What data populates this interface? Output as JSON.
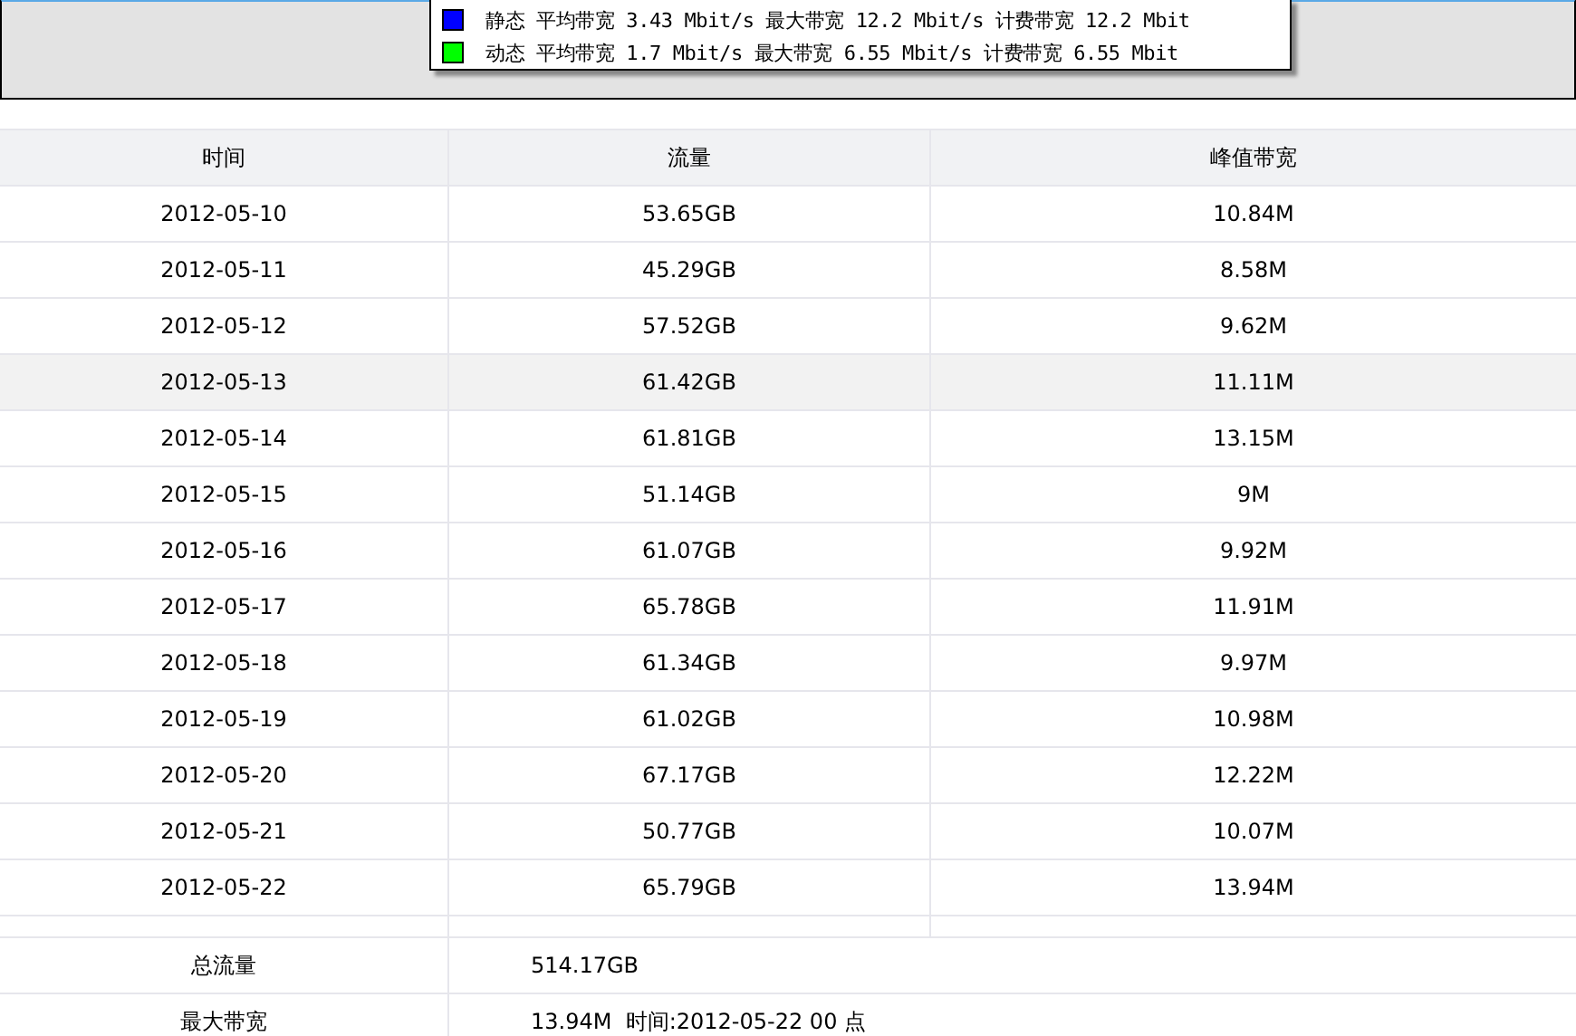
{
  "legend": [
    {
      "color": "#0000ff",
      "text": "静态 平均带宽 3.43 Mbit/s 最大带宽 12.2 Mbit/s 计费带宽 12.2 Mbit"
    },
    {
      "color": "#00ff00",
      "text": "动态 平均带宽 1.7 Mbit/s 最大带宽 6.55 Mbit/s 计费带宽 6.55 Mbit"
    }
  ],
  "table": {
    "columns": [
      "时间",
      "流量",
      "峰值带宽"
    ],
    "rows": [
      {
        "cells": [
          "2012-05-10",
          "53.65GB",
          "10.84M"
        ],
        "selected": false
      },
      {
        "cells": [
          "2012-05-11",
          "45.29GB",
          "8.58M"
        ],
        "selected": false
      },
      {
        "cells": [
          "2012-05-12",
          "57.52GB",
          "9.62M"
        ],
        "selected": false
      },
      {
        "cells": [
          "2012-05-13",
          "61.42GB",
          "11.11M"
        ],
        "selected": true
      },
      {
        "cells": [
          "2012-05-14",
          "61.81GB",
          "13.15M"
        ],
        "selected": false
      },
      {
        "cells": [
          "2012-05-15",
          "51.14GB",
          "9M"
        ],
        "selected": false
      },
      {
        "cells": [
          "2012-05-16",
          "61.07GB",
          "9.92M"
        ],
        "selected": false
      },
      {
        "cells": [
          "2012-05-17",
          "65.78GB",
          "11.91M"
        ],
        "selected": false
      },
      {
        "cells": [
          "2012-05-18",
          "61.34GB",
          "9.97M"
        ],
        "selected": false
      },
      {
        "cells": [
          "2012-05-19",
          "61.02GB",
          "10.98M"
        ],
        "selected": false
      },
      {
        "cells": [
          "2012-05-20",
          "67.17GB",
          "12.22M"
        ],
        "selected": false
      },
      {
        "cells": [
          "2012-05-21",
          "50.77GB",
          "10.07M"
        ],
        "selected": false
      },
      {
        "cells": [
          "2012-05-22",
          "65.79GB",
          "13.94M"
        ],
        "selected": false
      }
    ]
  },
  "summary": [
    {
      "label": "总流量",
      "value": "514.17GB"
    },
    {
      "label": "最大带宽",
      "value": "13.94M  时间:2012-05-22 00 点"
    }
  ]
}
